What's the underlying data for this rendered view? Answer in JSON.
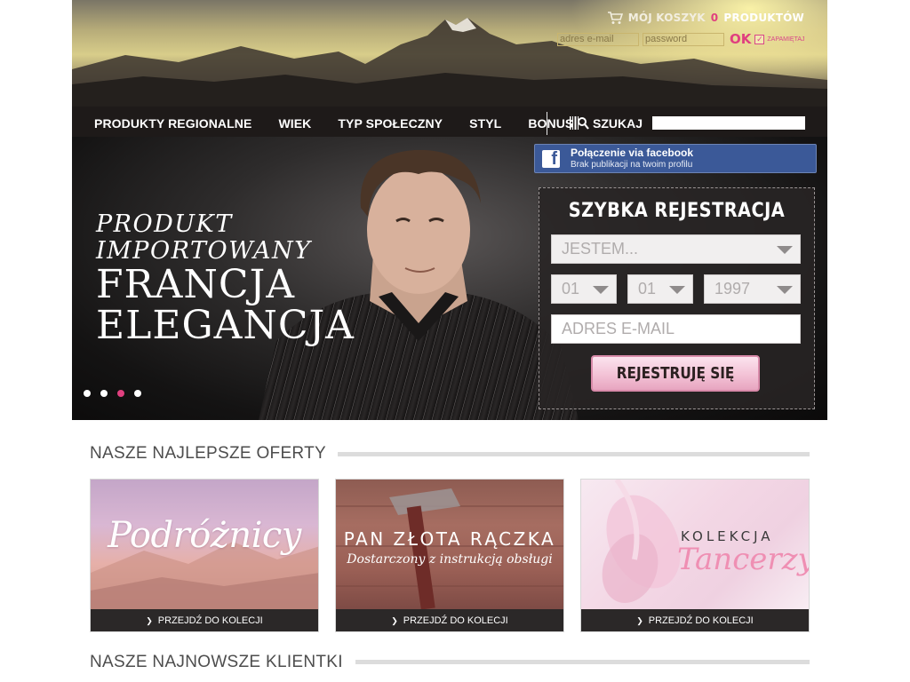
{
  "header": {
    "cart": {
      "prefix": "MÓJ KOSZYK",
      "count": "0",
      "suffix": "PRODUKTÓW"
    },
    "login": {
      "email_placeholder": "adres e-mail",
      "password_placeholder": "password",
      "ok_label": "OK",
      "remember_label": "ZAPAMIĘTAJ"
    },
    "nav": [
      "PRODUKTY REGIONALNE",
      "WIEK",
      "TYP SPOŁECZNY",
      "STYL",
      "BONUS"
    ],
    "search": {
      "label": "SZUKAJ",
      "value": ""
    }
  },
  "hero": {
    "line1": "PRODUKT",
    "line2": "IMPORTOWANY",
    "line3": "FRANCJA",
    "line4": "ELEGANCJA",
    "slides": 4,
    "active_slide": 3
  },
  "facebook": {
    "title": "Połączenie via facebook",
    "subtitle": "Brak publikacji na twoim profilu"
  },
  "registration": {
    "title": "SZYBKA REJESTRACJA",
    "gender_placeholder": "JESTEM...",
    "day": "01",
    "month": "01",
    "year": "1997",
    "email_placeholder": "ADRES E-MAIL",
    "submit_label": "REJESTRUJĘ SIĘ"
  },
  "offers": {
    "title": "NASZE NAJLEPSZE OFERTY",
    "items": [
      {
        "name": "Podróżnicy",
        "link": "PRZEJDŹ DO KOLECJI"
      },
      {
        "name": "PAN ZŁOTA RĄCZKA",
        "subtitle": "Dostarczony z instrukcją obsługi",
        "link": "PRZEJDŹ DO KOLECJI"
      },
      {
        "name_top": "KOLEKCJA",
        "name": "Tancerzy",
        "link": "PRZEJDŹ DO KOLECJI"
      }
    ]
  },
  "clients": {
    "title": "NASZE NAJNOWSZE KLIENTKI"
  },
  "colors": {
    "accent": "#e0407f",
    "facebook": "#3b5998",
    "dark_bar": "#2b2828"
  }
}
